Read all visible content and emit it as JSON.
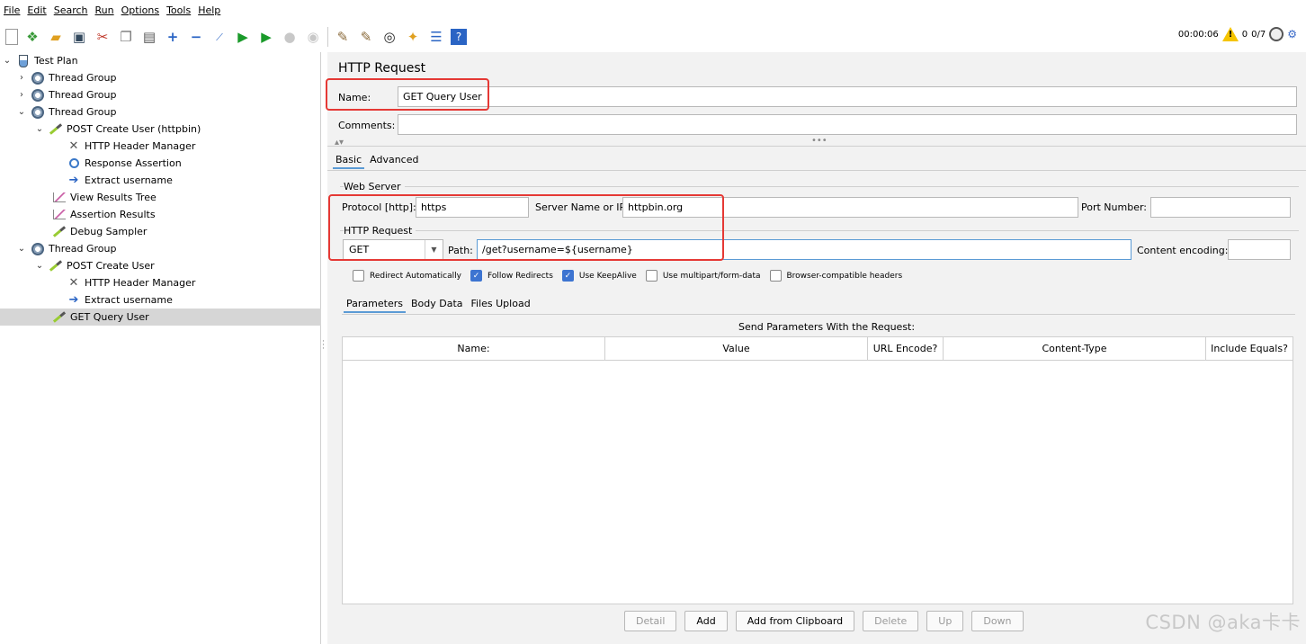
{
  "menu": [
    {
      "label": "File"
    },
    {
      "label": "Edit"
    },
    {
      "label": "Search"
    },
    {
      "label": "Run"
    },
    {
      "label": "Options"
    },
    {
      "label": "Tools"
    },
    {
      "label": "Help"
    }
  ],
  "toolbar": {
    "timer": "00:00:06",
    "warning_count": "0",
    "threads": "0/7"
  },
  "tree": {
    "items": [
      {
        "label": "Test Plan"
      },
      {
        "label": "Thread Group"
      },
      {
        "label": "Thread Group"
      },
      {
        "label": "Thread Group"
      },
      {
        "label": "POST Create User (httpbin)"
      },
      {
        "label": "HTTP Header Manager"
      },
      {
        "label": "Response Assertion"
      },
      {
        "label": "Extract username"
      },
      {
        "label": "View Results Tree"
      },
      {
        "label": "Assertion Results"
      },
      {
        "label": "Debug Sampler"
      },
      {
        "label": "Thread Group"
      },
      {
        "label": "POST Create User"
      },
      {
        "label": "HTTP Header Manager"
      },
      {
        "label": "Extract username"
      },
      {
        "label": "GET Query User"
      }
    ]
  },
  "panel": {
    "title": "HTTP Request",
    "name_label": "Name:",
    "name_value": "GET Query User",
    "comments_label": "Comments:",
    "comments_value": "",
    "tabs": [
      {
        "label": "Basic"
      },
      {
        "label": "Advanced"
      }
    ],
    "web_server_legend": "Web Server",
    "protocol_label": "Protocol [http]:",
    "protocol_value": "https",
    "server_label": "Server Name or IP:",
    "server_value": "httpbin.org",
    "port_label": "Port Number:",
    "port_value": "",
    "http_request_legend": "HTTP Request",
    "method_value": "GET",
    "path_label": "Path:",
    "path_value": "/get?username=${username}",
    "encoding_label": "Content encoding:",
    "encoding_value": "",
    "checkboxes": [
      {
        "label": "Redirect Automatically",
        "checked": false
      },
      {
        "label": "Follow Redirects",
        "checked": true
      },
      {
        "label": "Use KeepAlive",
        "checked": true
      },
      {
        "label": "Use multipart/form-data",
        "checked": false
      },
      {
        "label": "Browser-compatible headers",
        "checked": false
      }
    ],
    "param_tabs": [
      {
        "label": "Parameters"
      },
      {
        "label": "Body Data"
      },
      {
        "label": "Files Upload"
      }
    ],
    "send_params_label": "Send Parameters With the Request:",
    "columns": [
      "Name:",
      "Value",
      "URL Encode?",
      "Content-Type",
      "Include Equals?"
    ],
    "buttons": [
      {
        "label": "Detail",
        "enabled": false
      },
      {
        "label": "Add",
        "enabled": true
      },
      {
        "label": "Add from Clipboard",
        "enabled": true
      },
      {
        "label": "Delete",
        "enabled": false
      },
      {
        "label": "Up",
        "enabled": false
      },
      {
        "label": "Down",
        "enabled": false
      }
    ]
  },
  "watermark": "CSDN @aka卡卡"
}
